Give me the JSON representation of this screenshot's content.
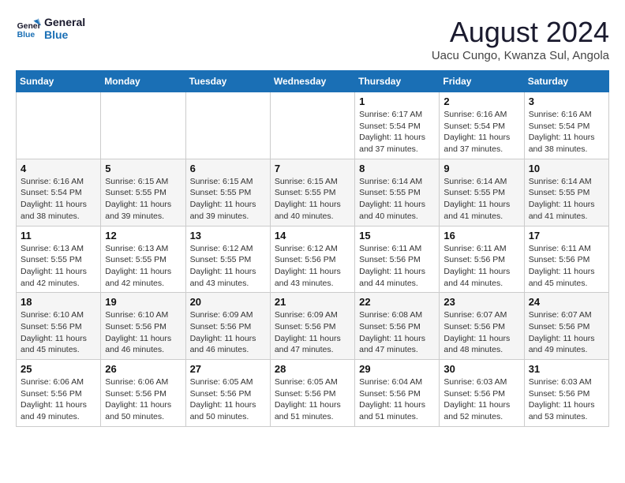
{
  "logo": {
    "line1": "General",
    "line2": "Blue"
  },
  "title": "August 2024",
  "location": "Uacu Cungo, Kwanza Sul, Angola",
  "weekdays": [
    "Sunday",
    "Monday",
    "Tuesday",
    "Wednesday",
    "Thursday",
    "Friday",
    "Saturday"
  ],
  "weeks": [
    [
      {
        "day": "",
        "info": ""
      },
      {
        "day": "",
        "info": ""
      },
      {
        "day": "",
        "info": ""
      },
      {
        "day": "",
        "info": ""
      },
      {
        "day": "1",
        "info": "Sunrise: 6:17 AM\nSunset: 5:54 PM\nDaylight: 11 hours\nand 37 minutes."
      },
      {
        "day": "2",
        "info": "Sunrise: 6:16 AM\nSunset: 5:54 PM\nDaylight: 11 hours\nand 37 minutes."
      },
      {
        "day": "3",
        "info": "Sunrise: 6:16 AM\nSunset: 5:54 PM\nDaylight: 11 hours\nand 38 minutes."
      }
    ],
    [
      {
        "day": "4",
        "info": "Sunrise: 6:16 AM\nSunset: 5:54 PM\nDaylight: 11 hours\nand 38 minutes."
      },
      {
        "day": "5",
        "info": "Sunrise: 6:15 AM\nSunset: 5:55 PM\nDaylight: 11 hours\nand 39 minutes."
      },
      {
        "day": "6",
        "info": "Sunrise: 6:15 AM\nSunset: 5:55 PM\nDaylight: 11 hours\nand 39 minutes."
      },
      {
        "day": "7",
        "info": "Sunrise: 6:15 AM\nSunset: 5:55 PM\nDaylight: 11 hours\nand 40 minutes."
      },
      {
        "day": "8",
        "info": "Sunrise: 6:14 AM\nSunset: 5:55 PM\nDaylight: 11 hours\nand 40 minutes."
      },
      {
        "day": "9",
        "info": "Sunrise: 6:14 AM\nSunset: 5:55 PM\nDaylight: 11 hours\nand 41 minutes."
      },
      {
        "day": "10",
        "info": "Sunrise: 6:14 AM\nSunset: 5:55 PM\nDaylight: 11 hours\nand 41 minutes."
      }
    ],
    [
      {
        "day": "11",
        "info": "Sunrise: 6:13 AM\nSunset: 5:55 PM\nDaylight: 11 hours\nand 42 minutes."
      },
      {
        "day": "12",
        "info": "Sunrise: 6:13 AM\nSunset: 5:55 PM\nDaylight: 11 hours\nand 42 minutes."
      },
      {
        "day": "13",
        "info": "Sunrise: 6:12 AM\nSunset: 5:55 PM\nDaylight: 11 hours\nand 43 minutes."
      },
      {
        "day": "14",
        "info": "Sunrise: 6:12 AM\nSunset: 5:56 PM\nDaylight: 11 hours\nand 43 minutes."
      },
      {
        "day": "15",
        "info": "Sunrise: 6:11 AM\nSunset: 5:56 PM\nDaylight: 11 hours\nand 44 minutes."
      },
      {
        "day": "16",
        "info": "Sunrise: 6:11 AM\nSunset: 5:56 PM\nDaylight: 11 hours\nand 44 minutes."
      },
      {
        "day": "17",
        "info": "Sunrise: 6:11 AM\nSunset: 5:56 PM\nDaylight: 11 hours\nand 45 minutes."
      }
    ],
    [
      {
        "day": "18",
        "info": "Sunrise: 6:10 AM\nSunset: 5:56 PM\nDaylight: 11 hours\nand 45 minutes."
      },
      {
        "day": "19",
        "info": "Sunrise: 6:10 AM\nSunset: 5:56 PM\nDaylight: 11 hours\nand 46 minutes."
      },
      {
        "day": "20",
        "info": "Sunrise: 6:09 AM\nSunset: 5:56 PM\nDaylight: 11 hours\nand 46 minutes."
      },
      {
        "day": "21",
        "info": "Sunrise: 6:09 AM\nSunset: 5:56 PM\nDaylight: 11 hours\nand 47 minutes."
      },
      {
        "day": "22",
        "info": "Sunrise: 6:08 AM\nSunset: 5:56 PM\nDaylight: 11 hours\nand 47 minutes."
      },
      {
        "day": "23",
        "info": "Sunrise: 6:07 AM\nSunset: 5:56 PM\nDaylight: 11 hours\nand 48 minutes."
      },
      {
        "day": "24",
        "info": "Sunrise: 6:07 AM\nSunset: 5:56 PM\nDaylight: 11 hours\nand 49 minutes."
      }
    ],
    [
      {
        "day": "25",
        "info": "Sunrise: 6:06 AM\nSunset: 5:56 PM\nDaylight: 11 hours\nand 49 minutes."
      },
      {
        "day": "26",
        "info": "Sunrise: 6:06 AM\nSunset: 5:56 PM\nDaylight: 11 hours\nand 50 minutes."
      },
      {
        "day": "27",
        "info": "Sunrise: 6:05 AM\nSunset: 5:56 PM\nDaylight: 11 hours\nand 50 minutes."
      },
      {
        "day": "28",
        "info": "Sunrise: 6:05 AM\nSunset: 5:56 PM\nDaylight: 11 hours\nand 51 minutes."
      },
      {
        "day": "29",
        "info": "Sunrise: 6:04 AM\nSunset: 5:56 PM\nDaylight: 11 hours\nand 51 minutes."
      },
      {
        "day": "30",
        "info": "Sunrise: 6:03 AM\nSunset: 5:56 PM\nDaylight: 11 hours\nand 52 minutes."
      },
      {
        "day": "31",
        "info": "Sunrise: 6:03 AM\nSunset: 5:56 PM\nDaylight: 11 hours\nand 53 minutes."
      }
    ]
  ]
}
